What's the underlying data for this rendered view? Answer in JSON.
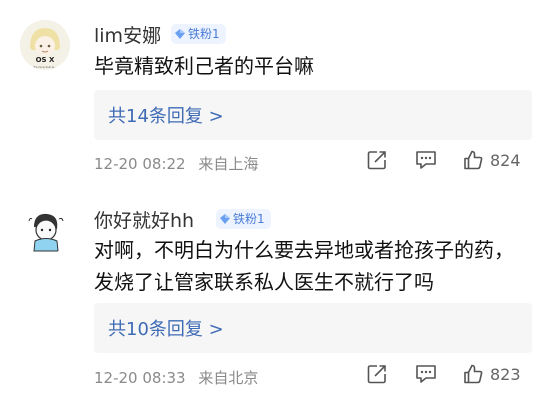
{
  "comments": [
    {
      "username": "lim安娜",
      "badge": "铁粉1",
      "avatar_caption": "OS X",
      "avatar_subcaption": "it's nice but is...",
      "text": "毕竟精致利己者的平台嘛",
      "reply_link": "共14条回复 >",
      "time": "12-20 08:22",
      "location": "来自上海",
      "likes": "824"
    },
    {
      "username": "你好就好hh",
      "badge": "铁粉1",
      "text": "对啊，不明白为什么要去异地或者抢孩子的药，发烧了让管家联系私人医生不就行了吗",
      "reply_link": "共10条回复 >",
      "time": "12-20 08:33",
      "location": "来自北京",
      "likes": "823"
    }
  ],
  "icons": [
    "share-icon",
    "comment-icon",
    "like-icon",
    "diamond-icon"
  ],
  "colors": {
    "link": "#3f6bb5",
    "badge_bg": "#eef4ff",
    "badge_text": "#4a7dd9",
    "meta": "#8a8a8a"
  }
}
